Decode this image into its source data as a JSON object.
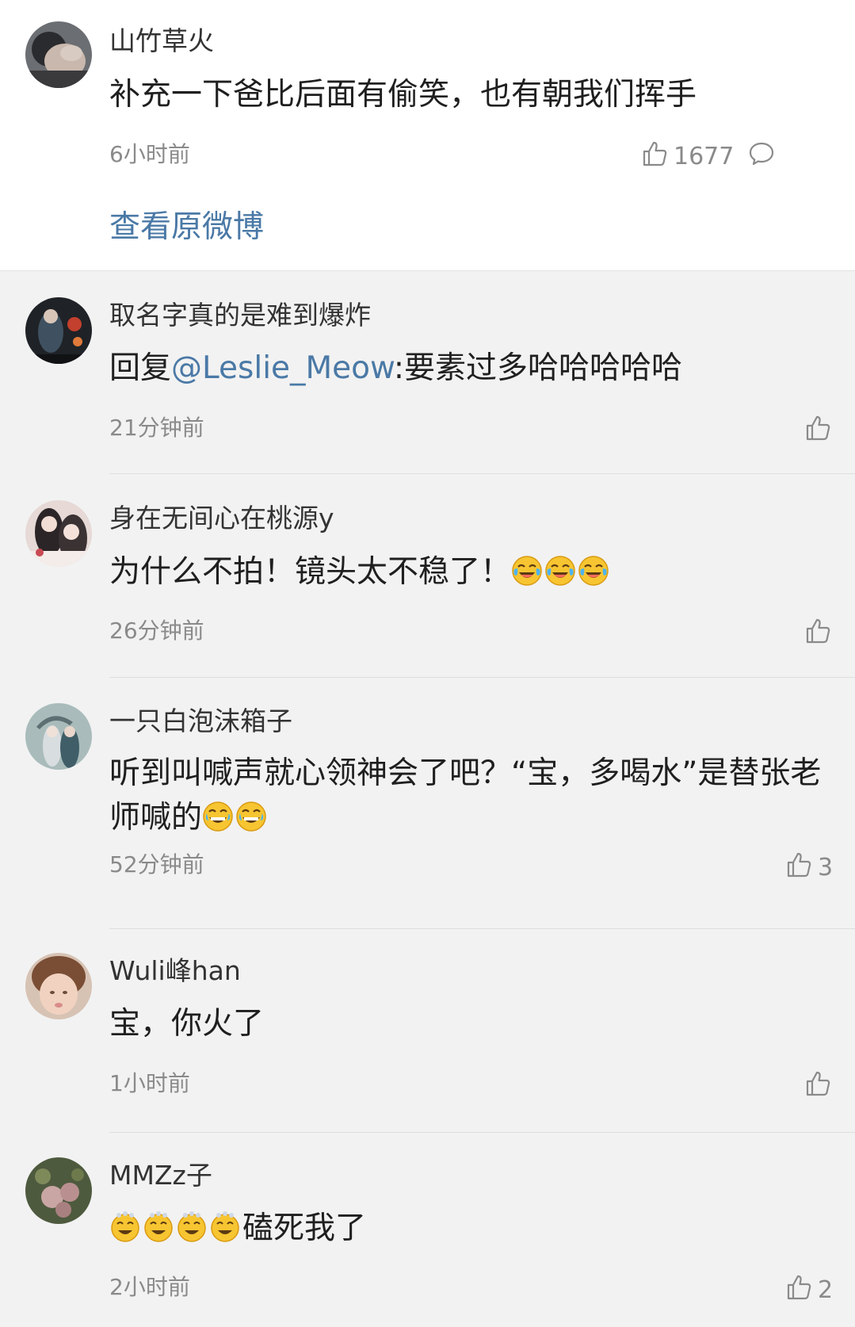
{
  "top_comment": {
    "username": "山竹草火",
    "text": "补充一下爸比后面有偷笑，也有朝我们挥手",
    "time": "6小时前",
    "likes": "1677",
    "view_original": "查看原微博"
  },
  "replies": [
    {
      "username": "取名字真的是难到爆炸",
      "prefix": "回复",
      "mention": "@Leslie_Meow",
      "text": ":要素过多哈哈哈哈哈",
      "time": "21分钟前",
      "likes": ""
    },
    {
      "username": "身在无间心在桃源y",
      "text": "为什么不拍！镜头太不稳了！",
      "emoji": "crying-laughing",
      "emoji_count": 3,
      "time": "26分钟前",
      "likes": ""
    },
    {
      "username": "一只白泡沫箱子",
      "text": "听到叫喊声就心领神会了吧？“宝，多喝水”是替张老师喊的",
      "emoji": "tears-of-joy",
      "emoji_count": 2,
      "time": "52分钟前",
      "likes": "3"
    },
    {
      "username": "Wuli峰han",
      "text": "宝，你火了",
      "time": "1小时前",
      "likes": ""
    },
    {
      "username": "MMZz子",
      "text": "磕死我了",
      "emoji": "dizzy-face",
      "emoji_count": 4,
      "time": "2小时前",
      "likes": "2"
    }
  ],
  "colors": {
    "link": "#4a79a6",
    "meta": "#8a8a8a",
    "background": "#f2f2f2"
  }
}
